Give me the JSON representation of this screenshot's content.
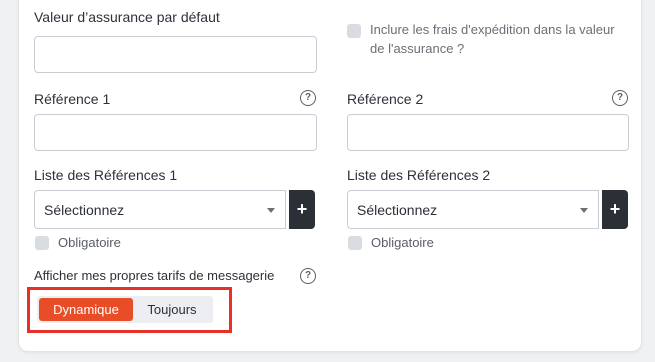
{
  "form": {
    "insurance_value_label": "Valeur d’assurance par défaut",
    "include_shipping_label_line1": "Inclure les frais d'expédition dans la valeur",
    "include_shipping_label_line2": "de l'assurance ?",
    "reference1_label": "Référence 1",
    "reference2_label": "Référence 2",
    "help_glyph": "?",
    "references_list1_label": "Liste des Références 1",
    "references_list2_label": "Liste des Références 2",
    "select_placeholder": "Sélectionnez",
    "add_glyph": "+",
    "mandatory_label": "Obligatoire",
    "own_rates_label": "Afficher mes propres tarifs de messagerie",
    "toggle_options": [
      "Dynamique",
      "Toujours"
    ],
    "toggle_selected": "Dynamique"
  },
  "colors": {
    "accent": "#e84d27",
    "highlight_border": "#e8302b",
    "dark_button": "#2b2f36"
  }
}
